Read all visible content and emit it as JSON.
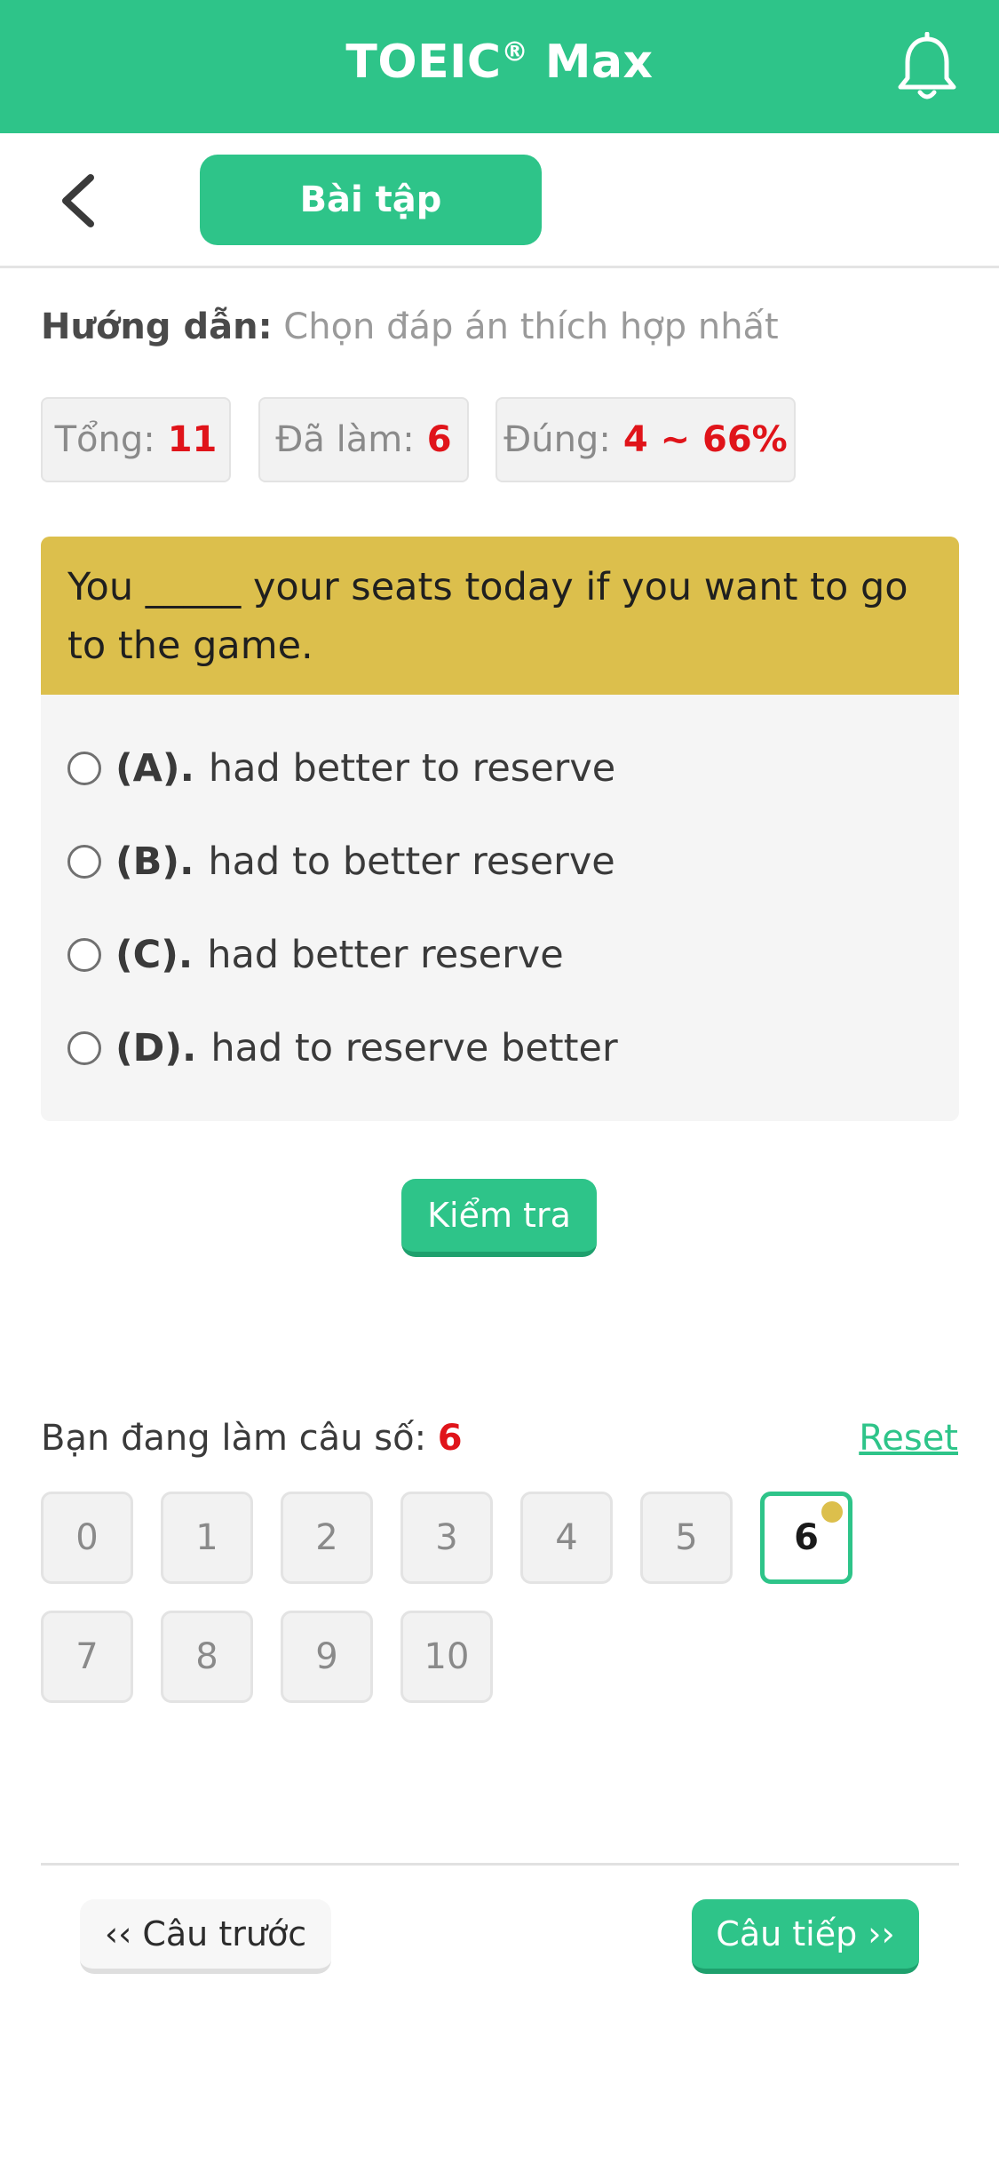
{
  "app": {
    "title": "TOEIC",
    "registered": "®",
    "title_suffix": " Max"
  },
  "icons": {
    "notifications": "bell-icon",
    "back": "chevron-left-icon"
  },
  "tab": {
    "label": "Bài tập"
  },
  "instruction": {
    "label": "Hướng dẫn:",
    "text": " Chọn đáp án thích hợp nhất"
  },
  "stats": {
    "total_label": "Tổng:",
    "total_value": "11",
    "done_label": "Đã làm:",
    "done_value": "6",
    "correct_label": "Đúng:",
    "correct_value": "4 ~ 66%"
  },
  "question": {
    "text": "You _____ your seats today if you want to go to the game.",
    "options": [
      {
        "letter": "(A).",
        "text": "had better to reserve"
      },
      {
        "letter": "(B).",
        "text": "had to better reserve"
      },
      {
        "letter": "(C).",
        "text": "had better reserve"
      },
      {
        "letter": "(D).",
        "text": "had to reserve better"
      }
    ]
  },
  "check_button": "Kiểm tra",
  "progress": {
    "label": "Bạn đang làm câu số: ",
    "current": "6",
    "reset": "Reset",
    "numbers": [
      "0",
      "1",
      "2",
      "3",
      "4",
      "5",
      "6",
      "7",
      "8",
      "9",
      "10"
    ]
  },
  "nav": {
    "prev": "‹‹ Câu trước",
    "next": "Câu tiếp ››"
  },
  "colors": {
    "primary": "#2ec489",
    "question_header": "#dcbf4c",
    "highlight_red": "#e0141a"
  }
}
